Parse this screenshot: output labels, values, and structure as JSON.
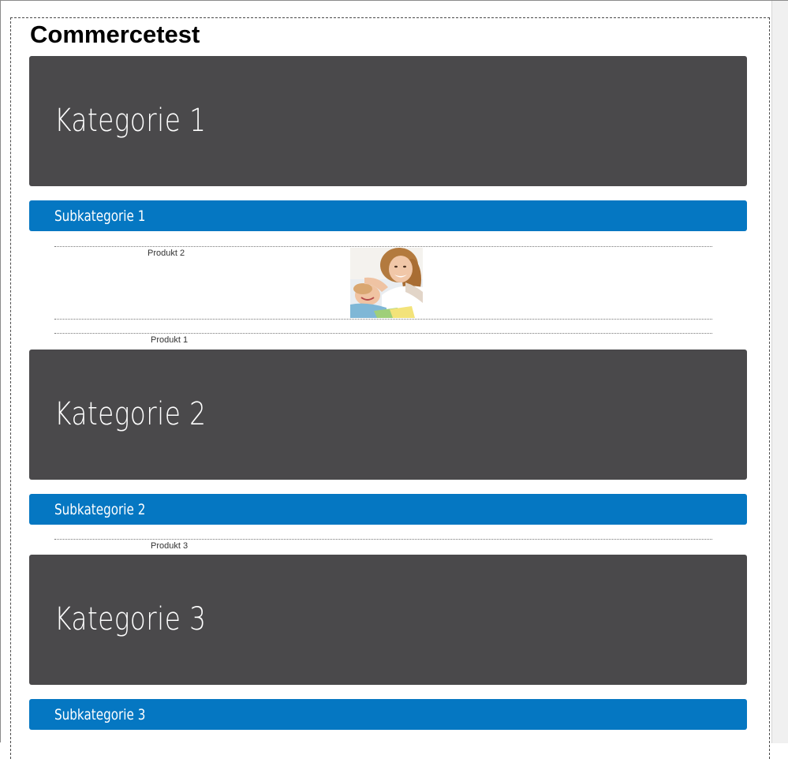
{
  "page": {
    "title": "Commercetest"
  },
  "categories": [
    {
      "title": "Kategorie 1",
      "subcategory": "Subkategorie 1",
      "products": [
        "Produkt 2",
        "Produkt 1"
      ]
    },
    {
      "title": "Kategorie 2",
      "subcategory": "Subkategorie 2",
      "products": [
        "Produkt 3"
      ]
    },
    {
      "title": "Kategorie 3",
      "subcategory": "Subkategorie 3",
      "products": []
    }
  ],
  "colors": {
    "category_bg": "#4a494b",
    "subcategory_bg": "#0577c2",
    "text_light": "#ffffff"
  },
  "icons": {
    "product_image": "photo-mother-child-icon"
  }
}
